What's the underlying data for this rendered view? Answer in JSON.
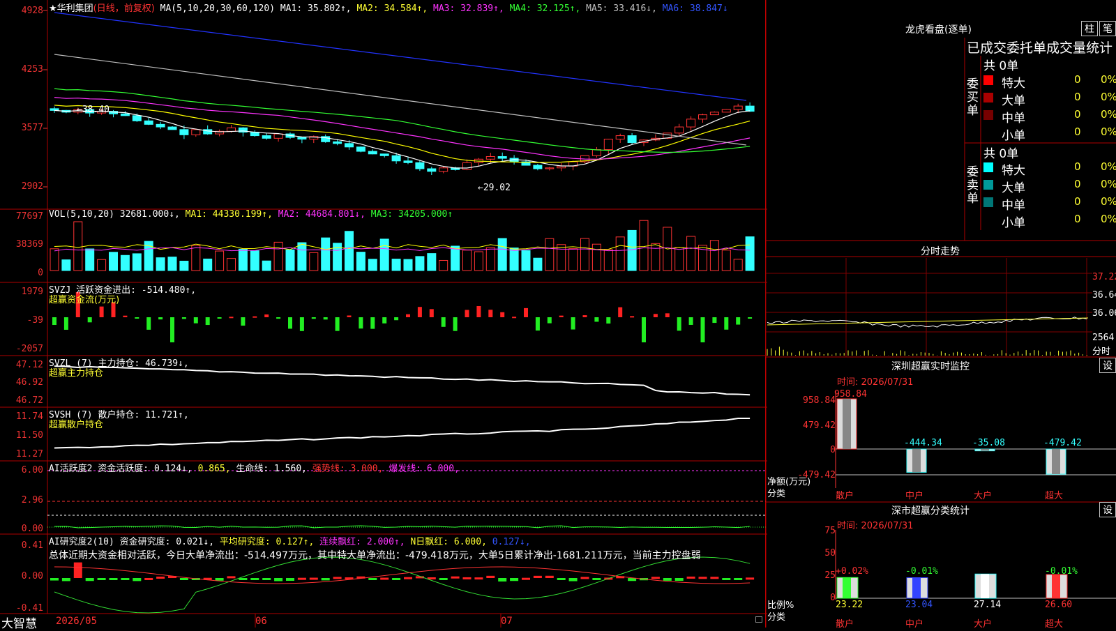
{
  "title": {
    "star": "★",
    "name": "华利集团",
    "period": "(日线，前复权)"
  },
  "ma": {
    "label": "MA(5,10,20,30,60,120)",
    "ma1": "MA1: 35.802↑,",
    "ma2": "MA2: 34.584↑,",
    "ma3": "MA3: 32.839↑,",
    "ma4": "MA4: 32.125↑,",
    "ma5": "MA5: 33.416↓,",
    "ma6": "MA6: 38.847↓"
  },
  "price_axis": [
    "4928",
    "4253",
    "3577",
    "2902"
  ],
  "price_notes": {
    "high": "38.40",
    "low": "29.02",
    "high_prefix": "←"
  },
  "vol": {
    "label": "VOL(5,10,20)",
    "value": "32681.000↓,",
    "ma1": "MA1: 44330.199↑,",
    "ma2": "MA2: 44684.801↓,",
    "ma3": "MA3: 34205.000↑",
    "axis": [
      "77697",
      "38369",
      "0"
    ]
  },
  "svzj": {
    "label": "SVZJ  活跃资金进出: -514.480↑,",
    "sub": "超赢资金流(万元)",
    "axis": [
      "1979",
      "-39",
      "-2057"
    ]
  },
  "svzl": {
    "label": "SVZL (7) 主力持仓: 46.739↓,",
    "sub": "超赢主力持仓",
    "axis": [
      "47.12",
      "46.92",
      "46.72"
    ]
  },
  "svsh": {
    "label": "SVSH (7) 散户持仓: 11.721↑,",
    "sub": "超赢散户持仓",
    "axis": [
      "11.74",
      "11.50",
      "11.27"
    ]
  },
  "ai2": {
    "label": "AI活跃度2 资金活跃度: 0.124↓,",
    "v2": "0.865,",
    "life": "生命线: 1.560,",
    "strong": "强势线: 3.000,",
    "burst": "爆发线: 6.000,",
    "axis": [
      "6.00",
      "2.96",
      "0.00"
    ]
  },
  "ai_research": {
    "label": "AI研究度2(10) 资金研究度: 0.021↓,",
    "avg": "平均研究度: 0.127↑,",
    "cont": "连续飘红: 2.000↑,",
    "nday": "N日飘红: 6.000,",
    "v": "0.127↓,",
    "summary": "总体近期大资金相对活跃，今日大单净流出：-514.497万元，其中特大单净流出：-479.418万元，大单5日累计净出-1681.211万元，当前主力控盘弱",
    "axis": [
      "0.41",
      "0.00",
      "-0.41"
    ]
  },
  "date_axis": [
    "2026/05",
    "06",
    "07"
  ],
  "brand": "大智慧",
  "lhb": {
    "title": "龙虎看盘(逐单)",
    "btn1": "柱",
    "btn2": "笔",
    "heading": "已成交委托单成交量统计",
    "buy": {
      "side": "委买单",
      "total": "共 0单",
      "rows": [
        {
          "label": "特大",
          "qty": "0",
          "pct": "0%",
          "color": "#ff0000"
        },
        {
          "label": "大单",
          "qty": "0",
          "pct": "0%",
          "color": "#aa0000"
        },
        {
          "label": "中单",
          "qty": "0",
          "pct": "0%",
          "color": "#770000"
        },
        {
          "label": "小单",
          "qty": "0",
          "pct": "0%",
          "color": "#000000"
        }
      ]
    },
    "sell": {
      "side": "委卖单",
      "total": "共 0单",
      "rows": [
        {
          "label": "特大",
          "qty": "0",
          "pct": "0%",
          "color": "#00ffff"
        },
        {
          "label": "大单",
          "qty": "0",
          "pct": "0%",
          "color": "#009999"
        },
        {
          "label": "中单",
          "qty": "0",
          "pct": "0%",
          "color": "#007777"
        },
        {
          "label": "小单",
          "qty": "0",
          "pct": "0%",
          "color": "#000000"
        }
      ]
    }
  },
  "intraday": {
    "title": "分时走势",
    "axis": [
      "37.22",
      "36.64",
      "36.06"
    ],
    "vol_label": "2564",
    "vol_unit": "分时"
  },
  "monitor": {
    "title": "深圳超赢实时监控",
    "btn": "设",
    "time": "时间: 2026/07/31",
    "axis": [
      "958.84",
      "479.42",
      "0",
      "-479.42"
    ],
    "ylabel": "净额(万元)",
    "xlabel": "分类",
    "cats": [
      "散户",
      "中户",
      "大户",
      "超大"
    ],
    "values": [
      958.84,
      -444.34,
      -35.08,
      -479.42
    ],
    "labels": [
      "958.84",
      "-444.34",
      "-35.08",
      "-479.42"
    ]
  },
  "classify": {
    "title": "深市超赢分类统计",
    "btn": "设",
    "time": "时间: 2026/07/31",
    "axis": [
      "75",
      "50",
      "25",
      "0"
    ],
    "ylabel": "比例%",
    "xlabel": "分类",
    "cats": [
      "散户",
      "中户",
      "大户",
      "超大"
    ],
    "values": [
      23.22,
      23.04,
      27.14,
      26.6
    ],
    "labels": [
      "23.22",
      "23.04",
      "27.14",
      "26.60"
    ],
    "changes": [
      "+0.02%",
      "-0.01%",
      "",
      "-0.01%"
    ]
  }
}
